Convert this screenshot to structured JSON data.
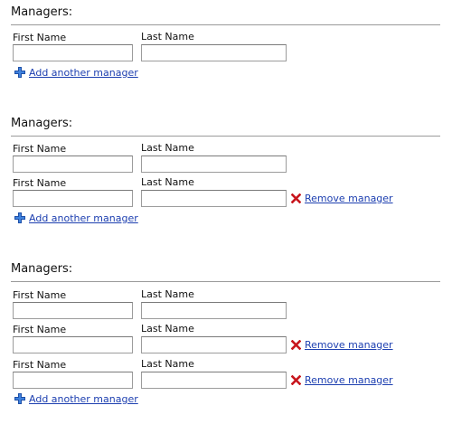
{
  "sections": [
    {
      "title": "Managers:",
      "rows": [
        {
          "first_name_label": "First Name",
          "last_name_label": "Last Name",
          "first_name_value": "",
          "last_name_value": ""
        }
      ],
      "add_label": "Add another manager"
    },
    {
      "title": "Managers:",
      "rows": [
        {
          "first_name_label": "First Name",
          "last_name_label": "Last Name",
          "first_name_value": "",
          "last_name_value": ""
        },
        {
          "first_name_label": "First Name",
          "last_name_label": "Last Name",
          "first_name_value": "",
          "last_name_value": "",
          "remove_label": "Remove manager"
        }
      ],
      "add_label": "Add another manager"
    },
    {
      "title": "Managers:",
      "rows": [
        {
          "first_name_label": "First Name",
          "last_name_label": "Last Name",
          "first_name_value": "",
          "last_name_value": ""
        },
        {
          "first_name_label": "First Name",
          "last_name_label": "Last Name",
          "first_name_value": "",
          "last_name_value": "",
          "remove_label": "Remove manager"
        },
        {
          "first_name_label": "First Name",
          "last_name_label": "Last Name",
          "first_name_value": "",
          "last_name_value": "",
          "remove_label": "Remove manager"
        }
      ],
      "add_label": "Add another manager"
    }
  ],
  "icons": {
    "add": "plus-icon",
    "remove": "x-icon"
  },
  "colors": {
    "link": "#1d3fb0",
    "add_icon": "#2f6fd1",
    "remove_icon": "#c8161d",
    "rule": "#9a9a9a",
    "field_border": "#9c9c9c"
  }
}
